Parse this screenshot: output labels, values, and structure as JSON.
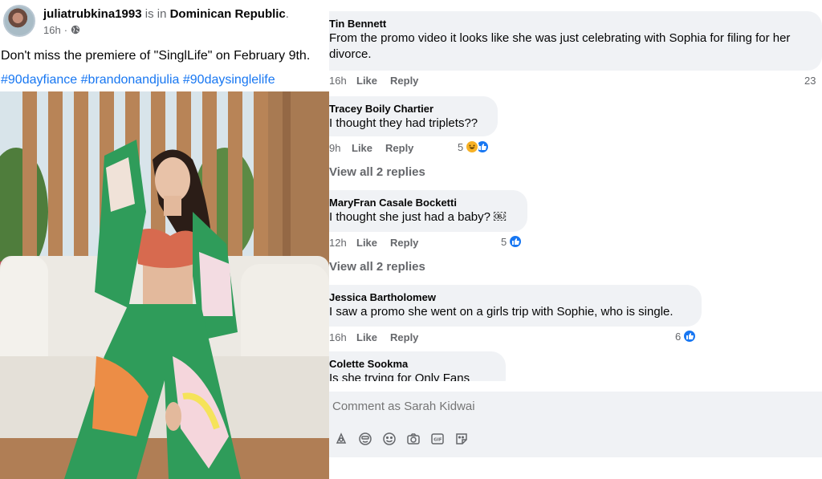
{
  "post": {
    "author": "juliatrubkina1993",
    "is_in": "is in",
    "location": "Dominican Republic",
    "location_suffix": ".",
    "time": "16h",
    "caption": "Don't miss the premiere of \"SinglLife\" on February 9th.",
    "hashtags": [
      "#90dayfiance",
      "#brandonandjulia",
      "#90daysinglelife"
    ],
    "photo_icon": "photo-of-woman-on-white-sofa"
  },
  "comments": [
    {
      "name": "Tin Bennett",
      "text_line1": "From the promo video it looks like she was just celebrating with Sophia for filing for her",
      "text_line2": "divorce.",
      "time": "16h",
      "like": "Like",
      "reply": "Reply",
      "reactions": "23"
    },
    {
      "name": "Tracey Boily Chartier",
      "text": "I thought they had triplets??",
      "time": "9h",
      "like": "Like",
      "reply": "Reply",
      "reactions": "5",
      "view_replies": "View all 2 replies"
    },
    {
      "name": "MaryFran Casale Bocketti",
      "text": "I thought she just had a baby? ￼",
      "time": "12h",
      "like": "Like",
      "reply": "Reply",
      "reactions": "5",
      "view_replies": "View all 2 replies"
    },
    {
      "name": "Jessica Bartholomew",
      "text": "I saw a promo she went on a girls trip with Sophie, who is single.",
      "time": "16h",
      "like": "Like",
      "reply": "Reply",
      "reactions": "6"
    },
    {
      "name": "Colette Sookma",
      "text": "Is she trying for Only Fans"
    }
  ],
  "composer": {
    "placeholder": "Comment as Sarah Kidwai",
    "icons": [
      "avatar-sticker-icon",
      "emoji-face-icon",
      "smiley-icon",
      "camera-icon",
      "gif-icon",
      "sticker-icon"
    ]
  },
  "colors": {
    "link_blue": "#1877f2",
    "bubble_gray": "#f0f2f5",
    "muted_text": "#65676b",
    "like_blue": "#1877f2",
    "haha_yellow": "#f7b125"
  }
}
